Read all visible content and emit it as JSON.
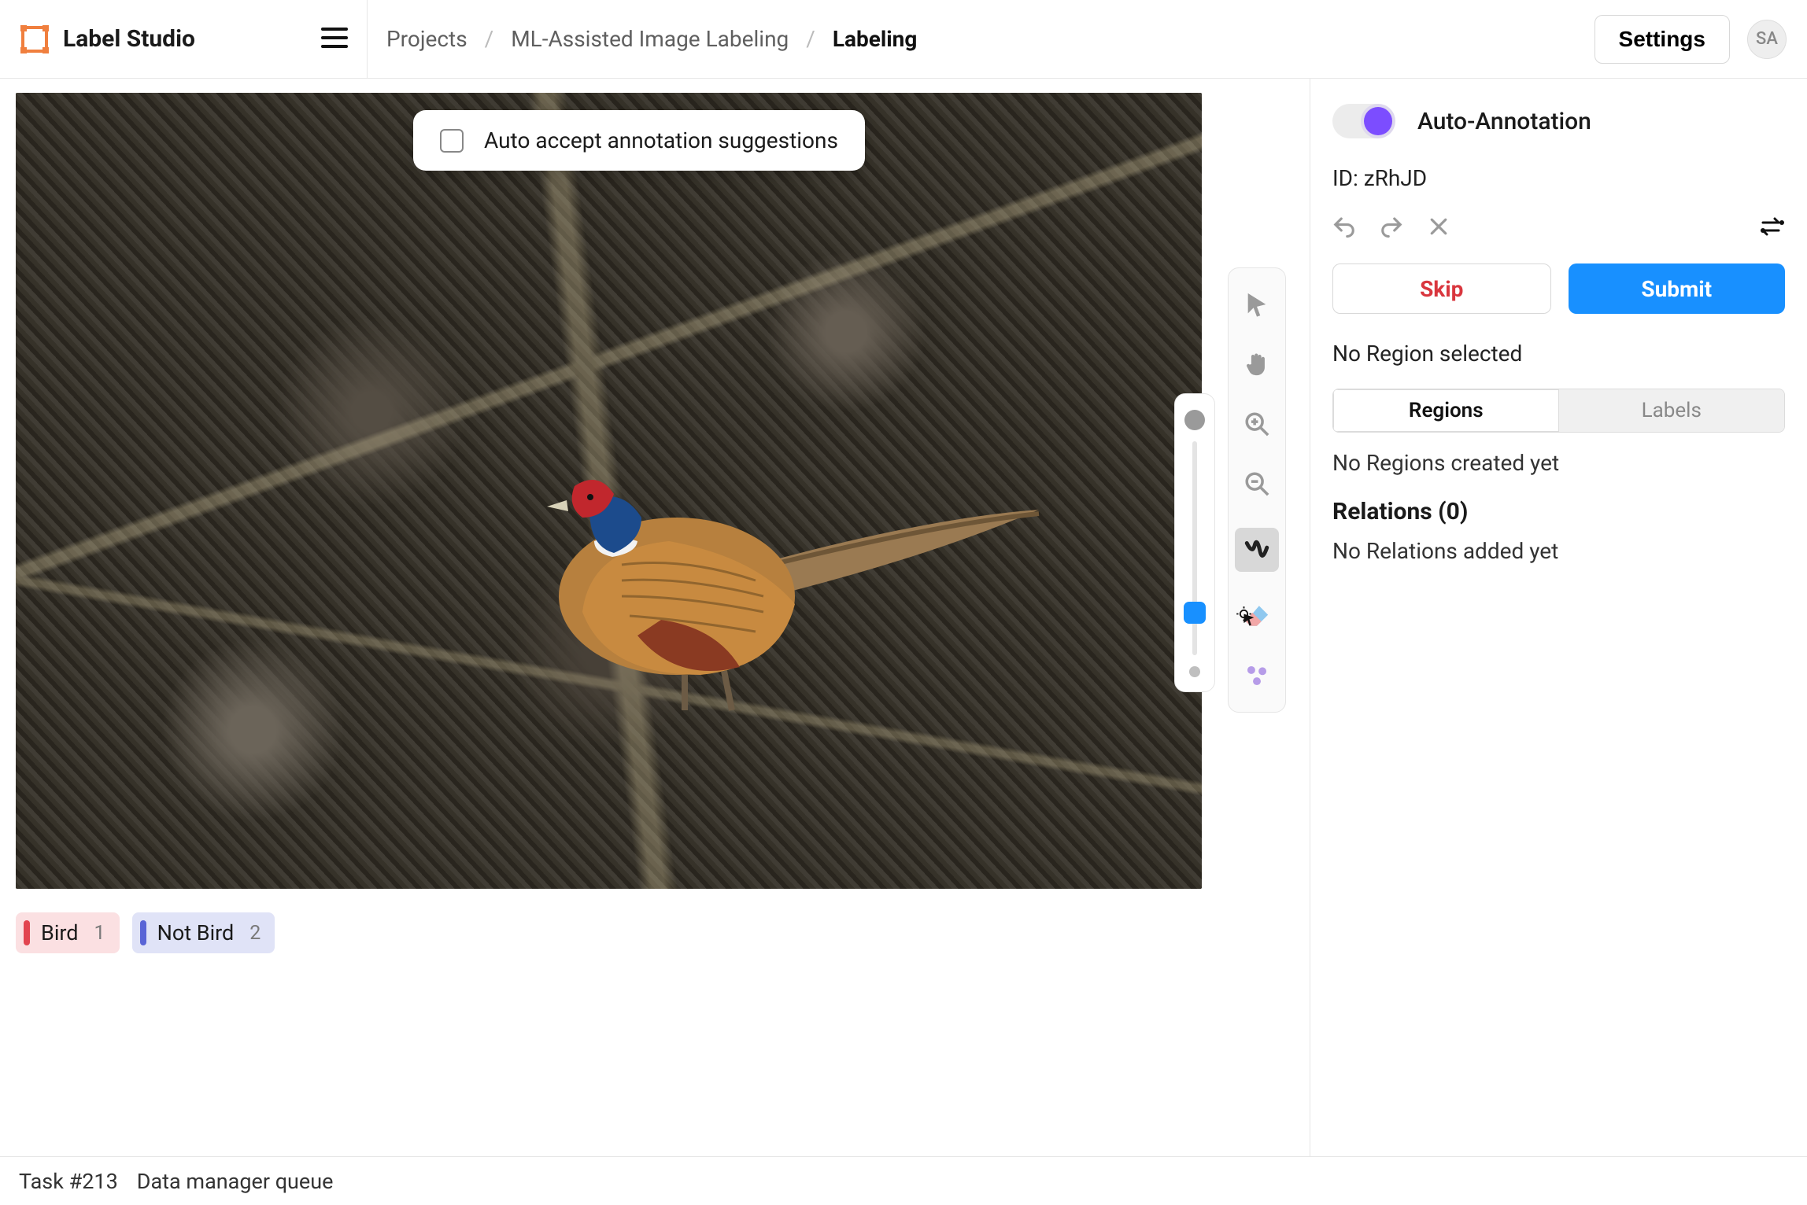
{
  "app": {
    "title": "Label Studio"
  },
  "header": {
    "breadcrumbs": [
      "Projects",
      "ML-Assisted Image Labeling",
      "Labeling"
    ],
    "settings_label": "Settings",
    "avatar_initials": "SA"
  },
  "canvas": {
    "auto_accept_label": "Auto accept annotation suggestions",
    "auto_accept_checked": false,
    "labels": [
      {
        "name": "Bird",
        "hotkey": "1",
        "color": "#e2444f",
        "bg": "#fbe0e2"
      },
      {
        "name": "Not Bird",
        "hotkey": "2",
        "color": "#5964d6",
        "bg": "#e0e3f7"
      }
    ]
  },
  "tools": {
    "items": [
      "pointer",
      "pan",
      "zoom-in",
      "zoom-out",
      "brush",
      "eraser",
      "keypoints"
    ],
    "active": "brush"
  },
  "sidebar": {
    "auto_annotation_label": "Auto-Annotation",
    "auto_annotation_on": true,
    "id_prefix": "ID: ",
    "id_value": "zRhJD",
    "skip_label": "Skip",
    "submit_label": "Submit",
    "no_region_selected": "No Region selected",
    "tabs": {
      "regions": "Regions",
      "labels": "Labels",
      "active": "regions"
    },
    "no_regions": "No Regions created yet",
    "relations_title": "Relations (0)",
    "no_relations": "No Relations added yet"
  },
  "footer": {
    "task_label": "Task #213",
    "queue_label": "Data manager queue"
  }
}
